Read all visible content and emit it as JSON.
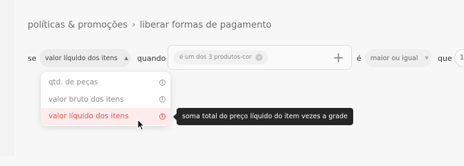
{
  "breadcrumb": {
    "parent": "políticas & promoções",
    "separator": "›",
    "current": "liberar formas de pagamento"
  },
  "rule": {
    "word_se": "se",
    "field_select": {
      "value": "valor líquido dos itens",
      "caret": "▲"
    },
    "word_quando": "quando",
    "products": {
      "tag": "é um dos 3 produtos-cor",
      "tag_close": "×",
      "add": "+"
    },
    "word_e": "é",
    "comparator_select": {
      "value": "maior ou igual",
      "caret": "▼"
    },
    "word_que": "que",
    "number_value": "1"
  },
  "dropdown": {
    "options": [
      {
        "label": "qtd. de peças",
        "info": "i"
      },
      {
        "label": "valor bruto dos itens",
        "info": "i"
      },
      {
        "label": "valor líquido dos itens",
        "info": "i"
      }
    ]
  },
  "tooltip": {
    "text": "soma total do preço líquido do item vezes a grade"
  },
  "colors": {
    "accent": "#e0544e",
    "active_bg": "#fdecec",
    "tooltip_bg": "#262626"
  }
}
